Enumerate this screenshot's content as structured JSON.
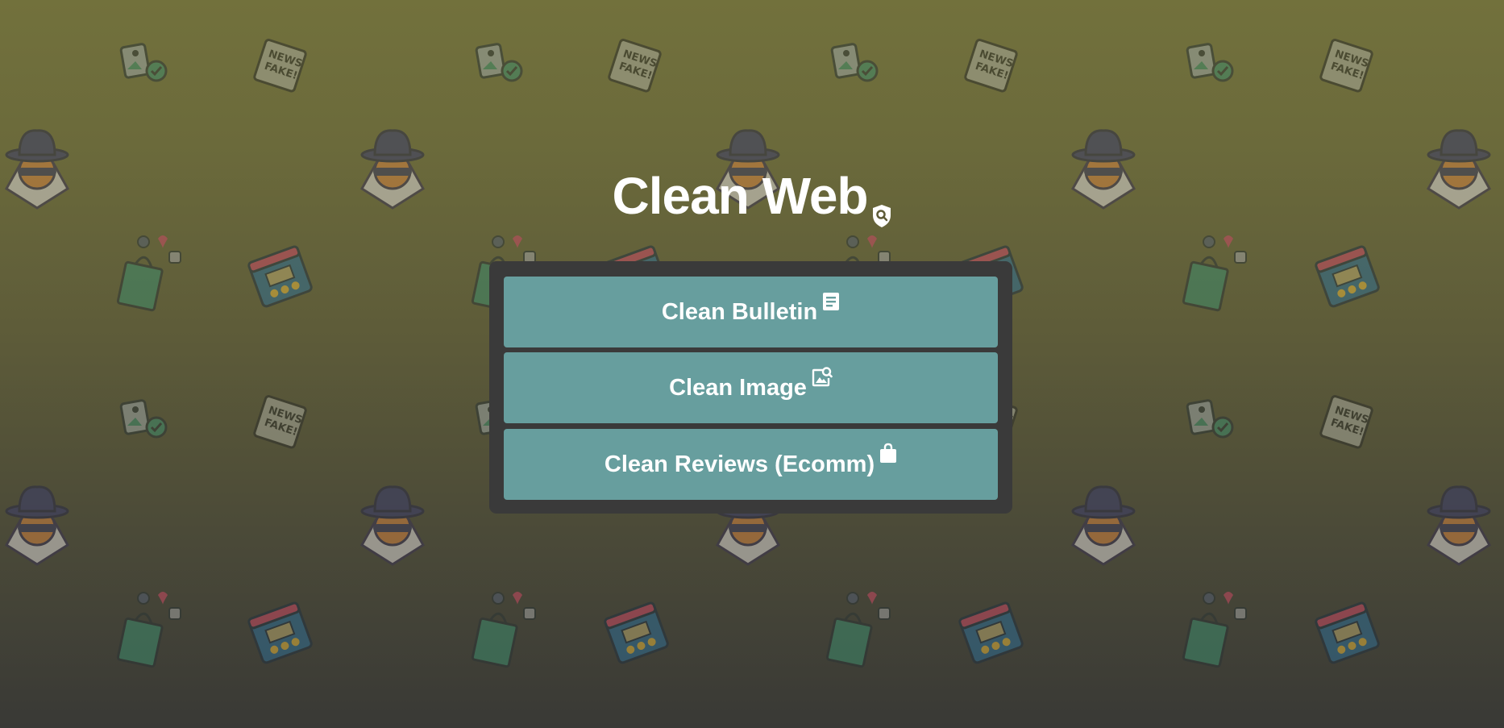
{
  "header": {
    "title": "Clean Web",
    "title_icon": "shield-search-icon"
  },
  "menu": {
    "items": [
      {
        "label": "Clean Bulletin",
        "icon": "document-icon"
      },
      {
        "label": "Clean Image",
        "icon": "image-search-icon"
      },
      {
        "label": "Clean Reviews (Ecomm)",
        "icon": "shopping-bag-icon"
      }
    ]
  },
  "background": {
    "icons": [
      "image-check-icon",
      "fake-news-icon",
      "spy-icon",
      "social-shopping-icon",
      "review-browser-icon"
    ]
  },
  "colors": {
    "gradient_top": "#72713c",
    "gradient_bottom": "#393936",
    "panel": "#3a3a3a",
    "button": "#679e9e",
    "text": "#ffffff"
  }
}
